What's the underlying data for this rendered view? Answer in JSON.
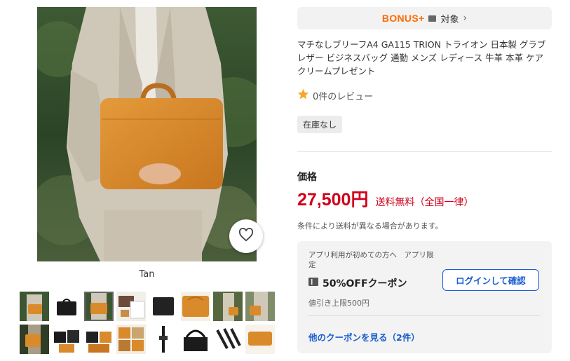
{
  "product": {
    "image_alt": "Tan briefcase held by model",
    "caption": "Tan",
    "title": "マチなしブリーフA4 GA115 TRION トライオン 日本製 グラブレザー ビジネスバッグ 通勤 メンズ レディース 牛革 本革 ケアクリームプレゼント",
    "review_text": "0件のレビュー",
    "stock_status": "在庫なし"
  },
  "bonus": {
    "logo": "BONUS+",
    "label": "対象",
    "chevron": "›"
  },
  "price": {
    "label": "価格",
    "amount": "27,500円",
    "shipping": "送料無料（全国一律）",
    "note": "条件により送料が異なる場合があります。"
  },
  "coupon": {
    "intro": "アプリ利用が初めての方へ　アプリ限定",
    "title": "50%OFFクーポン",
    "limit": "値引き上限500円",
    "login_button": "ログインして確認",
    "more_link": "他のクーポンを見る（2件）"
  },
  "colors": {
    "price_red": "#d0021b",
    "link_blue": "#1a5dd1",
    "bonus_orange": "#ff6b00",
    "star_gold": "#f5a623",
    "tan": "#d98a2b"
  },
  "thumbnails": [
    {
      "name": "model-tan"
    },
    {
      "name": "black-bag"
    },
    {
      "name": "model-tan-selected"
    },
    {
      "name": "material-card"
    },
    {
      "name": "black-bag-flat"
    },
    {
      "name": "tan-bag-closeup"
    },
    {
      "name": "model-walking"
    },
    {
      "name": "model-side"
    },
    {
      "name": "model-outdoor"
    },
    {
      "name": "black-bags-set"
    },
    {
      "name": "tan-bags-set"
    },
    {
      "name": "tan-detail-grid"
    },
    {
      "name": "black-strap"
    },
    {
      "name": "black-bag-handle"
    },
    {
      "name": "strap-detail"
    },
    {
      "name": "tan-bag-side"
    }
  ],
  "icons": {
    "favorite": "heart-icon",
    "star": "star-icon",
    "coupon": "coupon-icon",
    "bonus_card": "card-icon"
  }
}
